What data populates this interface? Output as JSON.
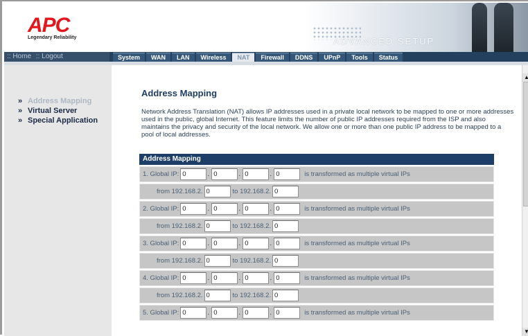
{
  "brand": {
    "logo_text": "APC",
    "tagline": "Legendary Reliability",
    "banner_text": "ADVANCED SETUP",
    "accent_red": "#e2171d",
    "nav_navy": "#23415f"
  },
  "top_links": {
    "home": ":: Home",
    "logout": ":: Logout"
  },
  "tabs": [
    {
      "label": "System"
    },
    {
      "label": "WAN"
    },
    {
      "label": "LAN"
    },
    {
      "label": "Wireless"
    },
    {
      "label": "NAT"
    },
    {
      "label": "Firewall"
    },
    {
      "label": "DDNS"
    },
    {
      "label": "UPnP"
    },
    {
      "label": "Tools"
    },
    {
      "label": "Status"
    }
  ],
  "active_tab": "NAT",
  "sidebar": {
    "items": [
      {
        "label": "Address Mapping"
      },
      {
        "label": "Virtual Server"
      },
      {
        "label": "Special Application"
      }
    ],
    "arrow": "»"
  },
  "page": {
    "title": "Address Mapping",
    "description": "Network Address Translation (NAT) allows IP addresses used in a private local network to be mapped to one or more addresses used in the public, global Internet. This feature limits the number of public IP addresses required from the ISP and also maintains the privacy and security of the local network. We allow one or more than one public IP address to be mapped to a pool of local addresses.",
    "panel_header": "Address Mapping",
    "transform_text": "is transformed as multiple virtual IPs",
    "from_text": "from  192.168.2.",
    "to_text": "to 192.168.2.",
    "mappings": [
      {
        "label": "1. Global IP:",
        "ip": [
          "0",
          "0",
          "0",
          "0"
        ],
        "from": "0",
        "to": "0"
      },
      {
        "label": "2. Global IP:",
        "ip": [
          "0",
          "0",
          "0",
          "0"
        ],
        "from": "0",
        "to": "0"
      },
      {
        "label": "3. Global IP:",
        "ip": [
          "0",
          "0",
          "0",
          "0"
        ],
        "from": "0",
        "to": "0"
      },
      {
        "label": "4. Global IP:",
        "ip": [
          "0",
          "0",
          "0",
          "0"
        ],
        "from": "0",
        "to": "0"
      },
      {
        "label": "5. Global IP:",
        "ip": [
          "0",
          "0",
          "0",
          "0"
        ]
      }
    ]
  }
}
